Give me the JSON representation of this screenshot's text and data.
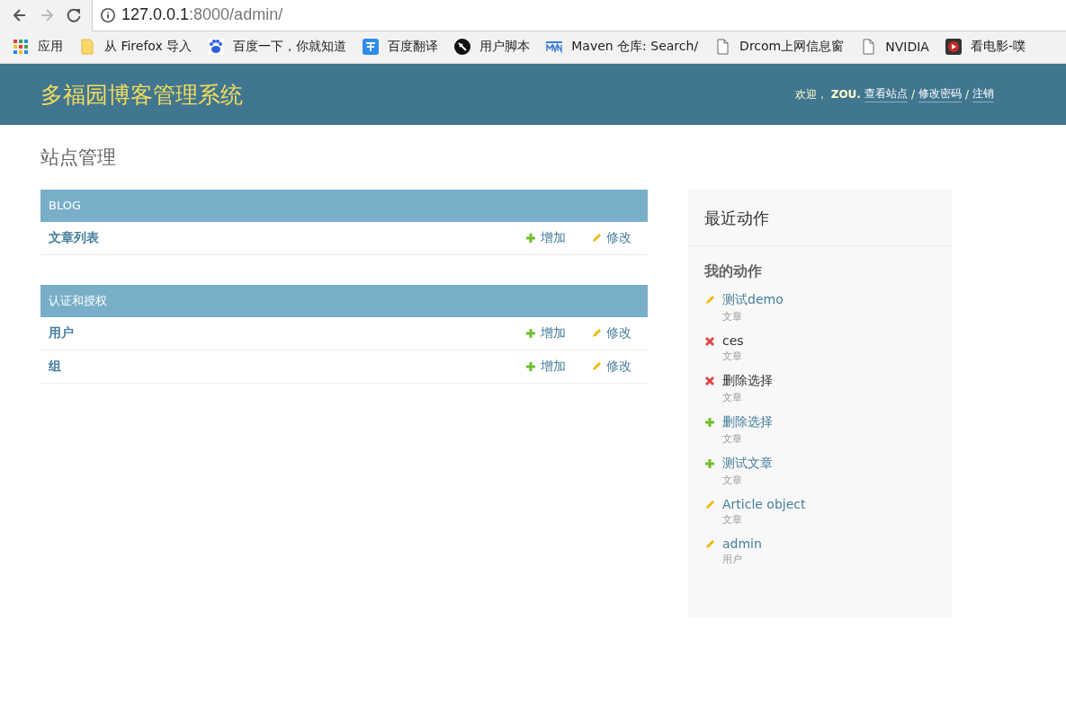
{
  "browser": {
    "url_host": "127.0.0.1",
    "url_path": ":8000/admin/",
    "bookmarks": [
      {
        "kind": "apps",
        "label": "应用"
      },
      {
        "kind": "folder",
        "label": "从 Firefox 导入"
      },
      {
        "kind": "paw",
        "label": "百度一下，你就知道"
      },
      {
        "kind": "translate",
        "label": "百度翻译"
      },
      {
        "kind": "fork",
        "label": "用户脚本"
      },
      {
        "kind": "mvn",
        "label": "Maven 仓库: Search/"
      },
      {
        "kind": "page",
        "label": "Drcom上网信息窗"
      },
      {
        "kind": "page",
        "label": "NVIDIA"
      },
      {
        "kind": "play",
        "label": "看电影-噗"
      }
    ]
  },
  "header": {
    "title": "多福园博客管理系统",
    "welcome": "欢迎，",
    "user": "ZOU.",
    "links": [
      {
        "label": "查看站点"
      },
      {
        "sep": "/",
        "label": "修改密码"
      },
      {
        "sep": "/",
        "label": "注销"
      }
    ]
  },
  "page_title": "站点管理",
  "modules": [
    {
      "caption": "BLOG",
      "rows": [
        {
          "name": "文章列表",
          "add": "增加",
          "change": "修改"
        }
      ]
    },
    {
      "caption": "认证和授权",
      "rows": [
        {
          "name": "用户",
          "add": "增加",
          "change": "修改"
        },
        {
          "name": "组",
          "add": "增加",
          "change": "修改"
        }
      ]
    }
  ],
  "recent": {
    "title": "最近动作",
    "subtitle": "我的动作",
    "actions": [
      {
        "kind": "change",
        "label": "测试demo",
        "type": "文章"
      },
      {
        "kind": "delete",
        "label": "ces",
        "type": "文章"
      },
      {
        "kind": "delete",
        "label": "删除选择",
        "type": "文章"
      },
      {
        "kind": "add",
        "label": "删除选择",
        "type": "文章"
      },
      {
        "kind": "add",
        "label": "测试文章",
        "type": "文章"
      },
      {
        "kind": "change",
        "label": "Article object",
        "type": "文章"
      },
      {
        "kind": "change",
        "label": "admin",
        "type": "用户"
      }
    ]
  }
}
